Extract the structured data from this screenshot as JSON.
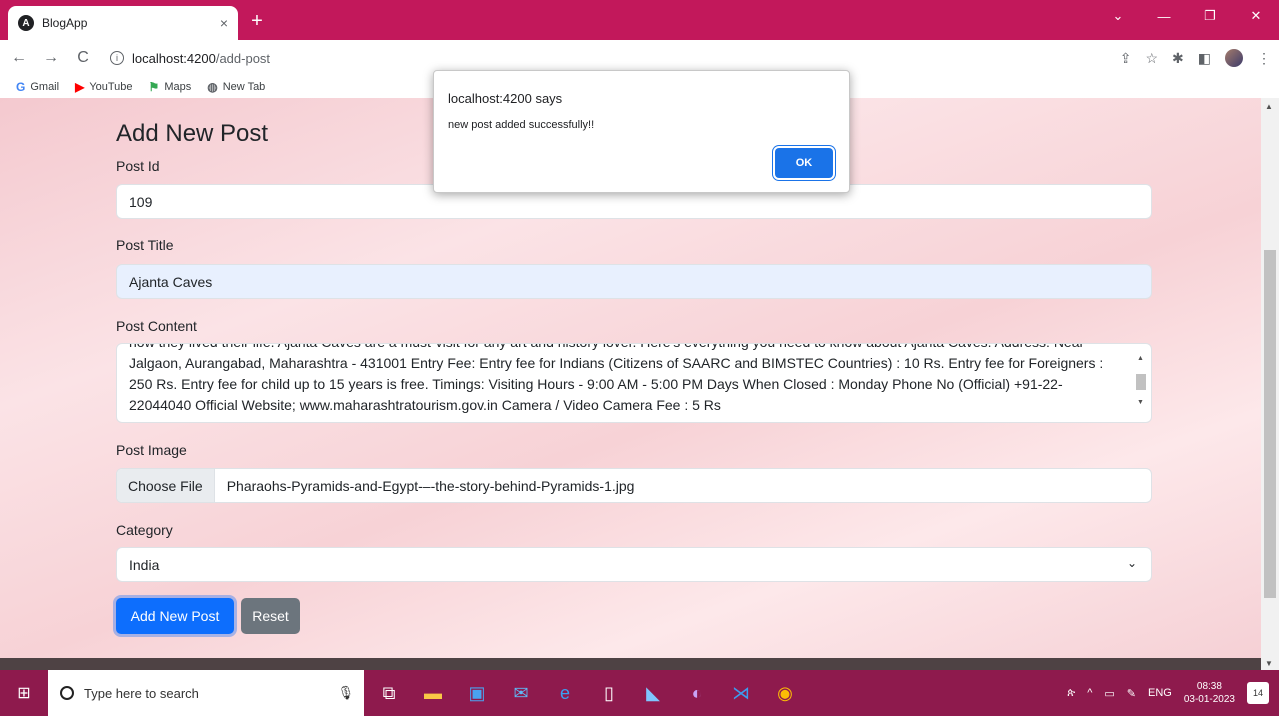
{
  "browser": {
    "tab_title": "BlogApp",
    "tab_close": "×",
    "new_tab": "+",
    "url_host": "localhost:4200",
    "url_path": "/add-post",
    "bookmarks": [
      "Gmail",
      "YouTube",
      "Maps",
      "New Tab"
    ]
  },
  "form": {
    "heading": "Add New Post",
    "post_id_label": "Post Id",
    "post_id_value": "109",
    "post_title_label": "Post Title",
    "post_title_value": "Ajanta Caves",
    "post_content_label": "Post Content",
    "post_content_value": "how they lived their life. Ajanta Caves are a must-visit for any art and history lover. Here's everything you need to know about Ajanta Caves. Address: Near Jalgaon, Aurangabad, Maharashtra - 431001 Entry Fee: Entry fee for Indians (Citizens of SAARC and BIMSTEC Countries) : 10 Rs. Entry fee for Foreigners : 250 Rs. Entry fee for child up to 15 years is free. Timings: Visiting Hours - 9:00 AM - 5:00 PM Days When Closed : Monday Phone No (Official) +91-22-22044040 Official Website; www.maharashtratourism.gov.in Camera / Video Camera Fee : 5 Rs",
    "post_image_label": "Post Image",
    "choose_file_label": "Choose File",
    "file_name": "Pharaohs-Pyramids-and-Egypt-–-the-story-behind-Pyramids-1.jpg",
    "category_label": "Category",
    "category_value": "India",
    "submit_label": "Add New Post",
    "reset_label": "Reset"
  },
  "dialog": {
    "title": "localhost:4200 says",
    "message": "new post added successfully!!",
    "ok_label": "OK"
  },
  "taskbar": {
    "search_placeholder": "Type here to search",
    "language": "ENG",
    "time": "08:38",
    "date": "03-01-2023",
    "notifications": "14"
  }
}
